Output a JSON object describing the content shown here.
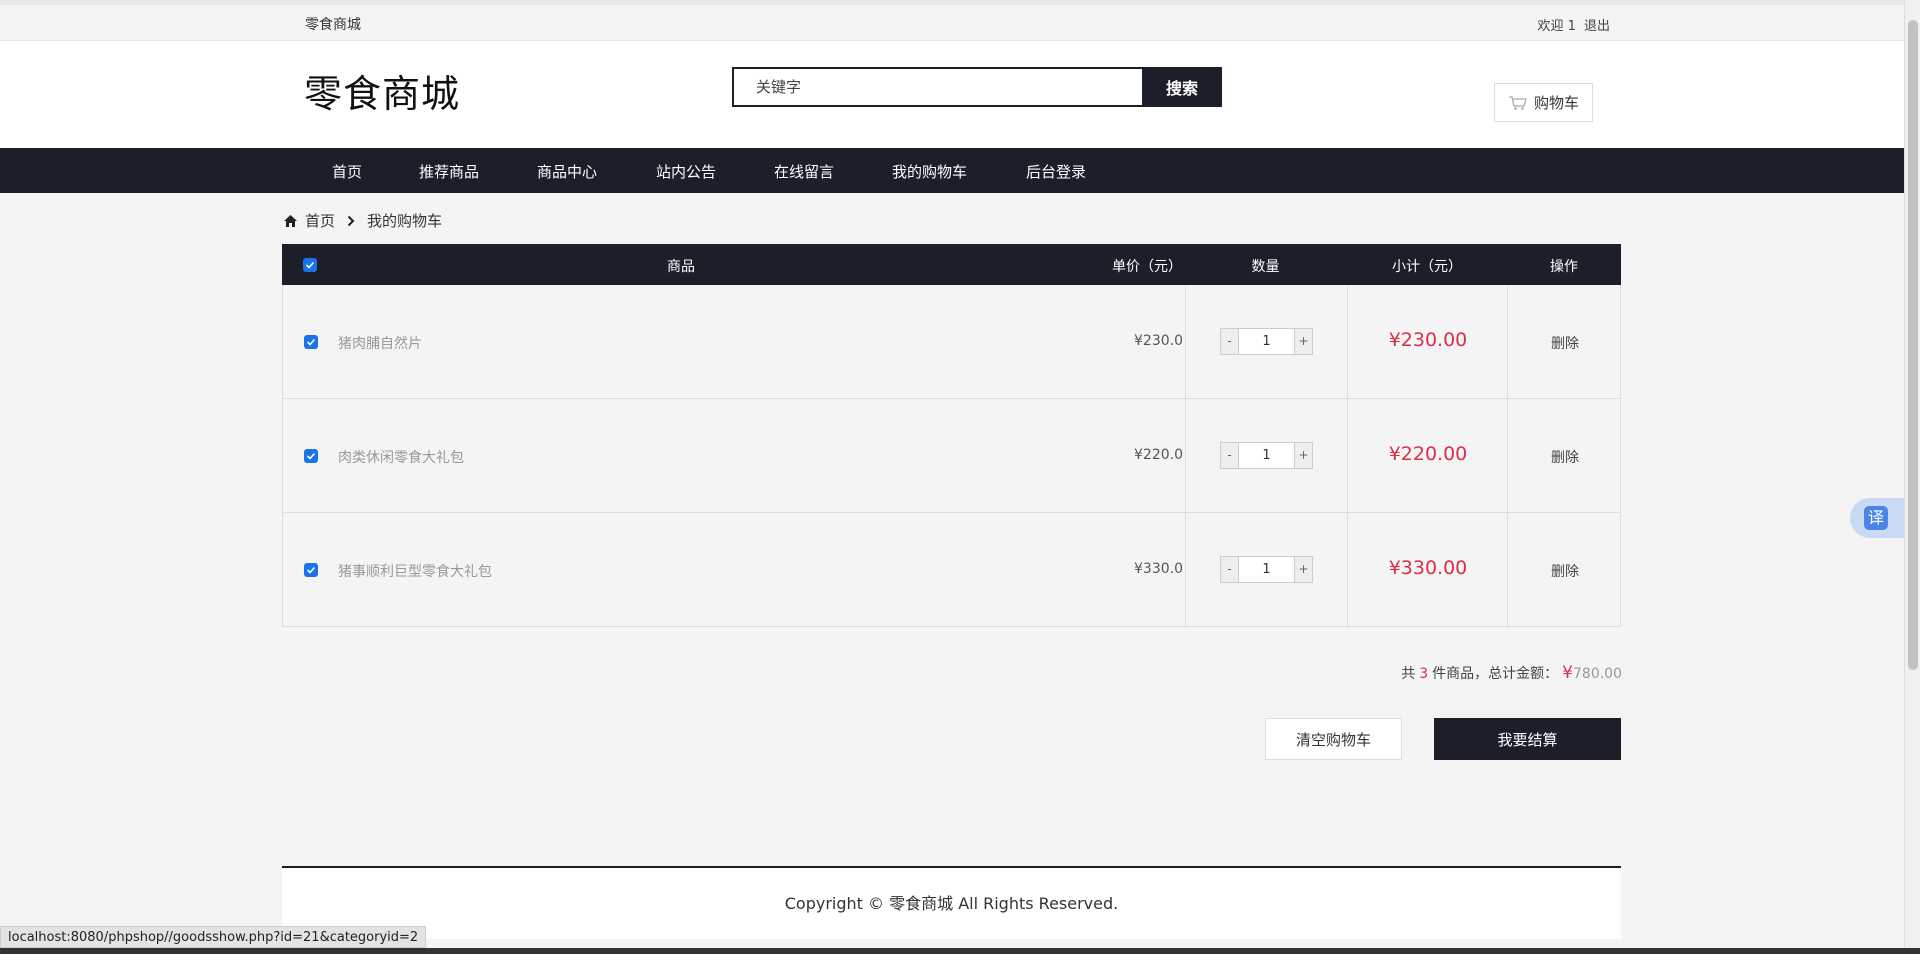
{
  "topbar": {
    "brand": "零食商城",
    "welcome": "欢迎 1",
    "logout": "退出"
  },
  "header": {
    "logo": "零食商城",
    "search_placeholder": "关键字",
    "search_button": "搜索",
    "cart_button": "购物车",
    "cart_icon": "shopping-cart-icon"
  },
  "nav": {
    "items": [
      "首页",
      "推荐商品",
      "商品中心",
      "站内公告",
      "在线留言",
      "我的购物车",
      "后台登录"
    ]
  },
  "breadcrumb": {
    "home_icon": "home-icon",
    "home": "首页",
    "separator_icon": "chevron-right-icon",
    "current": "我的购物车"
  },
  "cart": {
    "columns": {
      "product": "商品",
      "price": "单价（元）",
      "qty": "数量",
      "subtotal": "小计（元）",
      "action": "操作"
    },
    "select_all_checked": true,
    "rows": [
      {
        "checked": true,
        "name": "猪肉脯自然片",
        "price": "¥230.0",
        "qty": "1",
        "subtotal": "¥230.00",
        "delete": "删除"
      },
      {
        "checked": true,
        "name": "肉类休闲零食大礼包",
        "price": "¥220.0",
        "qty": "1",
        "subtotal": "¥220.00",
        "delete": "删除"
      },
      {
        "checked": true,
        "name": "猪事顺利巨型零食大礼包",
        "price": "¥330.0",
        "qty": "1",
        "subtotal": "¥330.00",
        "delete": "删除"
      }
    ],
    "qty_minus": "-",
    "qty_plus": "+",
    "summary": {
      "prefix": "共",
      "count": "3",
      "middle": "件商品，总计金额：",
      "currency": "¥",
      "total": "780.00"
    },
    "clear_button": "清空购物车",
    "checkout_button": "我要结算"
  },
  "footer": {
    "copyright": "Copyright © 零食商城 All Rights Reserved."
  },
  "status_bar": {
    "url": "localhost:8080/phpshop//goodsshow.php?id=21&categoryid=2"
  },
  "translate_widget": {
    "label": "译"
  },
  "colors": {
    "dark": "#1c1f2a",
    "price_red": "#d9304a",
    "checkbox_blue": "#1a73e8"
  }
}
